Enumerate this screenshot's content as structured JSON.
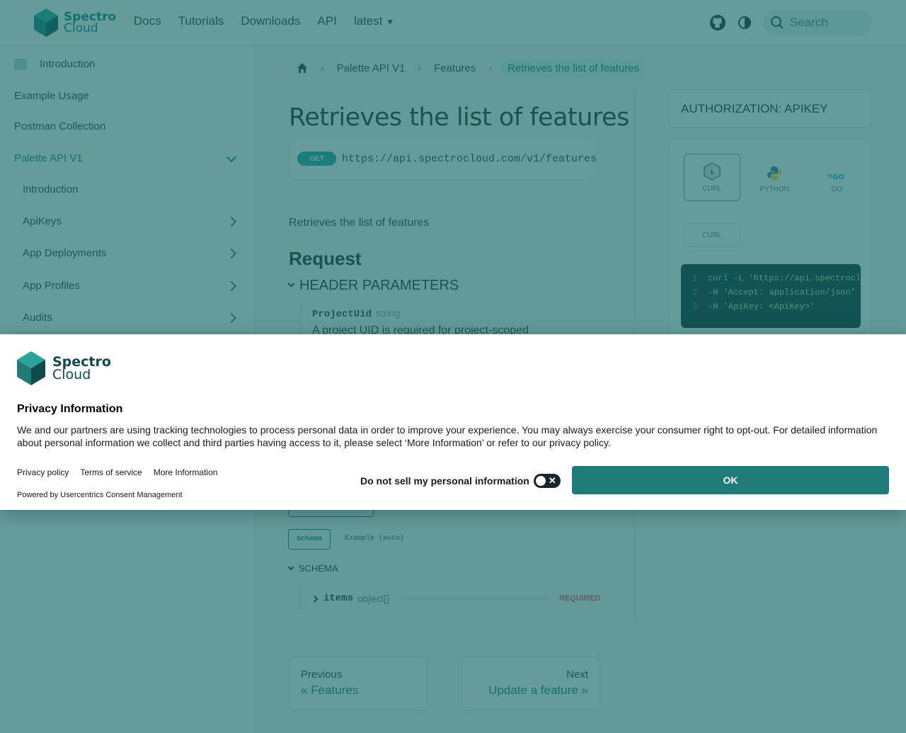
{
  "navbar": {
    "logo_line1": "Spectro",
    "logo_line2": "Cloud",
    "links": [
      "Docs",
      "Tutorials",
      "Downloads",
      "API"
    ],
    "version": "latest",
    "search_placeholder": "Search"
  },
  "sidebar": {
    "items": [
      {
        "label": "Introduction"
      },
      {
        "label": "Example Usage"
      },
      {
        "label": "Postman Collection"
      },
      {
        "label": "Palette API V1"
      }
    ],
    "sub_items": [
      {
        "label": "Introduction"
      },
      {
        "label": "ApiKeys"
      },
      {
        "label": "App Deployments"
      },
      {
        "label": "App Profiles"
      },
      {
        "label": "Audits"
      }
    ]
  },
  "breadcrumb": {
    "items": [
      "Palette API V1",
      "Features"
    ],
    "current": "Retrieves the list of features"
  },
  "main": {
    "title": "Retrieves the list of features",
    "method": "GET",
    "url": "https://api.spectrocloud.com/v1/features",
    "description": "Retrieves the list of features",
    "request_heading": "Request",
    "params_heading": "HEADER PARAMETERS",
    "param_name": "ProjectUid",
    "param_type": "string",
    "param_desc": "A project UID is required for project-scoped",
    "tab_schema": "Schema",
    "tab_example": "Example (auto)",
    "schema_heading": "SCHEMA",
    "item_name": "items",
    "item_type": "object[]",
    "required": "REQUIRED"
  },
  "pager": {
    "prev_label": "Previous",
    "prev_value": "« Features",
    "next_label": "Next",
    "next_value": "Update a feature »"
  },
  "right": {
    "auth": "AUTHORIZATION: APIKEY",
    "langs": [
      "CURL",
      "PYTHON",
      "GO"
    ],
    "sub_tab": "CURL",
    "code": [
      {
        "n": "1",
        "cmd": "curl",
        "flag": " -L ",
        "str": "'https://api.spectrocl"
      },
      {
        "n": "2",
        "cmd": "",
        "flag": "-H ",
        "str": "'Accept: application/json'"
      },
      {
        "n": "3",
        "cmd": "",
        "flag": "-H ",
        "str": "'ApiKey: <ApiKey>'"
      }
    ]
  },
  "consent": {
    "logo_line1": "Spectro",
    "logo_line2": "Cloud",
    "title": "Privacy Information",
    "text": "We and our partners are using tracking technologies to process personal data in order to improve your experience. You may always exercise your consumer right to opt-out. For detailed information about personal information we collect and third parties having access to it, please select ‘More Information’ or refer to our privacy policy.",
    "links": [
      "Privacy policy",
      "Terms of service",
      "More Information"
    ],
    "powered": "Powered by Usercentrics Consent Management",
    "dns_label": "Do not sell my personal information",
    "ok": "OK"
  },
  "colors": {
    "brand": "#1f7a78",
    "overlay": "#146968",
    "required": "#e5484d"
  }
}
